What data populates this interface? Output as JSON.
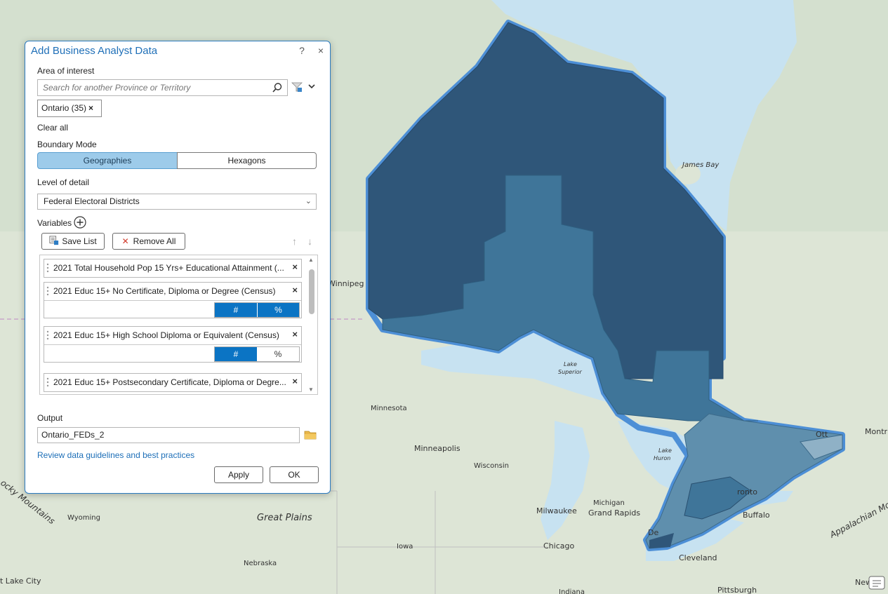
{
  "dialog": {
    "title": "Add Business Analyst Data",
    "help": "?",
    "close": "×",
    "area_label": "Area of interest",
    "search_placeholder": "Search for another Province or Territory",
    "chip": {
      "label": "Ontario (35)",
      "remove": "×"
    },
    "clear_all": "Clear all",
    "boundary_label": "Boundary Mode",
    "boundary_options": [
      "Geographies",
      "Hexagons"
    ],
    "boundary_selected": "Geographies",
    "level_label": "Level of detail",
    "level_value": "Federal Electoral Districts",
    "variables_label": "Variables",
    "save_list": "Save List",
    "remove_all": "Remove All",
    "variables": [
      {
        "name": "2021 Total Household Pop 15 Yrs+ Educational Attainment (...",
        "remove": "×"
      },
      {
        "name": "2021 Educ 15+ No Certificate, Diploma or Degree (Census)",
        "remove": "×",
        "toggle": [
          "#",
          "%"
        ],
        "selected": "#"
      },
      {
        "name": "2021 Educ 15+ High School Diploma or Equivalent (Census)",
        "remove": "×",
        "toggle": [
          "#",
          "%"
        ],
        "selected": "#"
      },
      {
        "name": "2021 Educ 15+ Postsecondary Certificate, Diploma or Degre...",
        "remove": "×"
      }
    ],
    "output_label": "Output",
    "output_value": "Ontario_FEDs_2",
    "guidelines_link": "Review data guidelines and best practices",
    "apply": "Apply",
    "ok": "OK"
  },
  "map": {
    "labels": {
      "winnipeg": "Winnipeg",
      "james_bay": "James Bay",
      "lake_superior_1": "Lake",
      "lake_superior_2": "Superior",
      "lake_huron_1": "Lake",
      "lake_huron_2": "Huron",
      "minnesota": "Minnesota",
      "minneapolis": "Minneapolis",
      "wisconsin": "Wisconsin",
      "michigan": "Michigan",
      "milwaukee": "Milwaukee",
      "grand_rapids": "Grand Rapids",
      "toronto": "ronto",
      "buffalo": "Buffalo",
      "detroit": "De",
      "cleveland": "Cleveland",
      "chicago": "Chicago",
      "iowa": "Iowa",
      "nebraska": "Nebraska",
      "wyoming": "Wyoming",
      "great_plains": "Great Plains",
      "rocky_mountains": "ocky Mountains",
      "salt_lake_city": "t Lake City",
      "appalachian": "Appalachian Mo",
      "ottawa": "Ott",
      "montreal": "Montr",
      "pittsburgh": "Pittsburgh",
      "indiana": "Indiana",
      "new_york": "New"
    },
    "colors": {
      "dark": "#2f5679",
      "mid": "#3f7599",
      "light": "#5f8fad",
      "outline": "#4d8fd6",
      "water": "#c7e2f1"
    }
  }
}
